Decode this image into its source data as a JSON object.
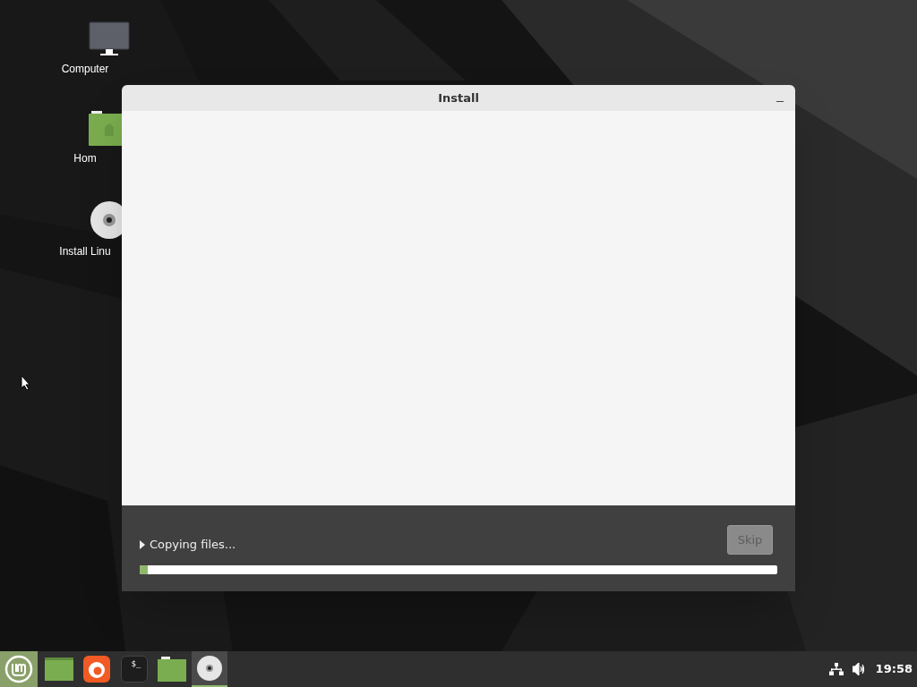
{
  "desktop_icons": [
    {
      "kind": "computer",
      "label": "Computer"
    },
    {
      "kind": "home",
      "label": "Hom"
    },
    {
      "kind": "disc",
      "label": "Install Linu"
    }
  ],
  "window": {
    "title": "Install",
    "expander": {
      "label": "Copying files...",
      "expanded": false
    },
    "skip_button": {
      "label": "Skip",
      "disabled": true
    },
    "progress": {
      "level": 0.012
    }
  },
  "taskbar": {
    "launchers": [
      {
        "kind": "desktop",
        "selected": false
      },
      {
        "kind": "browser",
        "selected": false
      },
      {
        "kind": "terminal",
        "text": "$_",
        "selected": false
      },
      {
        "kind": "folder",
        "selected": false
      },
      {
        "kind": "disc",
        "selected": true
      }
    ],
    "clock": "19:58"
  }
}
